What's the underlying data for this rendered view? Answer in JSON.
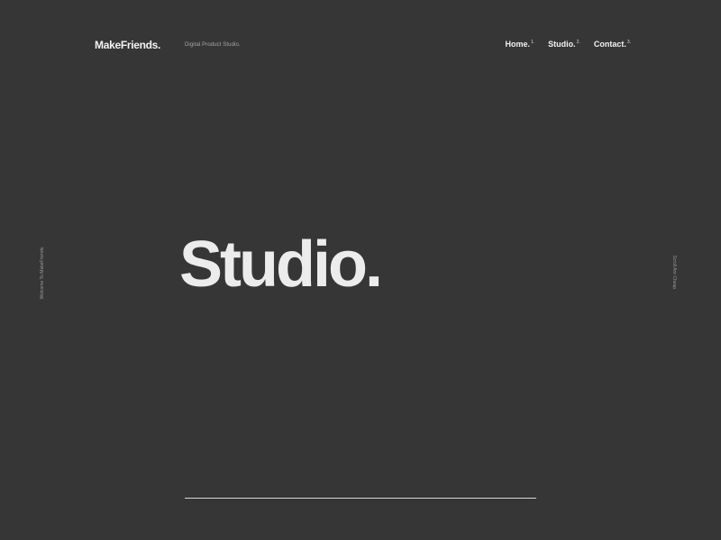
{
  "header": {
    "logo": "MakeFriends.",
    "tagline": "Digital Product Studio."
  },
  "nav": {
    "items": [
      {
        "label": "Home.",
        "number": "1."
      },
      {
        "label": "Studio.",
        "number": "2."
      },
      {
        "label": "Contact.",
        "number": "3."
      }
    ]
  },
  "side": {
    "left_text": "Welcome To MakeFriends.",
    "right_text": "Scroll Are Cheap."
  },
  "hero": {
    "title": "Studio."
  }
}
